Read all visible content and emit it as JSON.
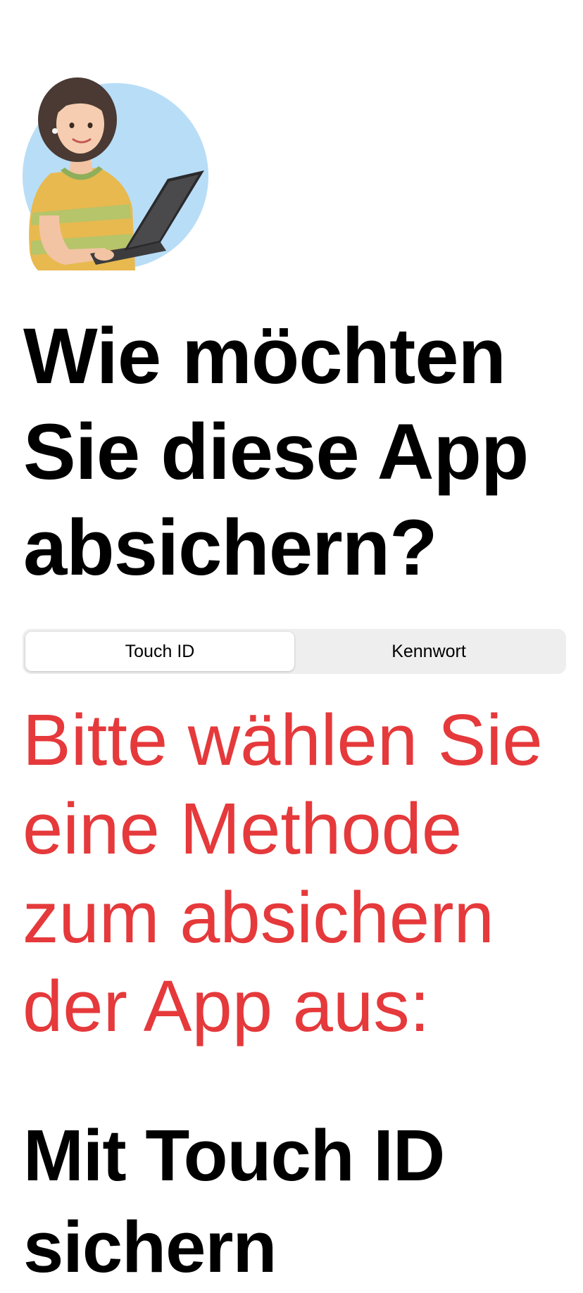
{
  "illustration": {
    "icon": "woman-with-laptop-illustration",
    "background_color": "#b8ddf7"
  },
  "heading": "Wie möchten Sie diese App absichern?",
  "segmented_control": {
    "options": [
      {
        "label": "Touch ID",
        "selected": true
      },
      {
        "label": "Kennwort",
        "selected": false
      }
    ]
  },
  "notice": {
    "text": "Bitte wählen Sie eine Methode zum absichern der App aus:",
    "color": "#e5393b"
  },
  "subheading": "Mit Touch ID sichern"
}
